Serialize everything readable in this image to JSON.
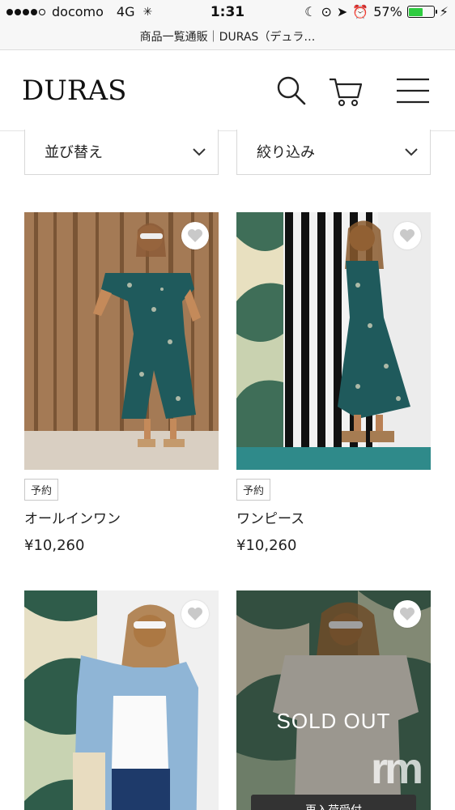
{
  "status_bar": {
    "carrier": "docomo",
    "network": "4G",
    "time": "1:31",
    "battery_percent": "57%",
    "battery_level": 0.57
  },
  "browser": {
    "title": "商品一覧通販｜DURAS（デュラ…"
  },
  "header": {
    "logo": "DURAS",
    "icons": [
      "search-icon",
      "cart-icon",
      "menu-icon"
    ]
  },
  "controls": {
    "sort_label": "並び替え",
    "filter_label": "絞り込み"
  },
  "products": [
    {
      "badge": "予約",
      "name": "オールインワン",
      "price": "¥10,260"
    },
    {
      "badge": "予約",
      "name": "ワンピース",
      "price": "¥10,260"
    },
    {},
    {
      "soldout_label": "SOLD OUT",
      "restock_label": "再入荷受付"
    }
  ],
  "colors": {
    "accent": "#2a2a2a",
    "battery_green": "#2ecc40",
    "dress_teal": "#1f5a5c"
  },
  "watermark": "rm"
}
